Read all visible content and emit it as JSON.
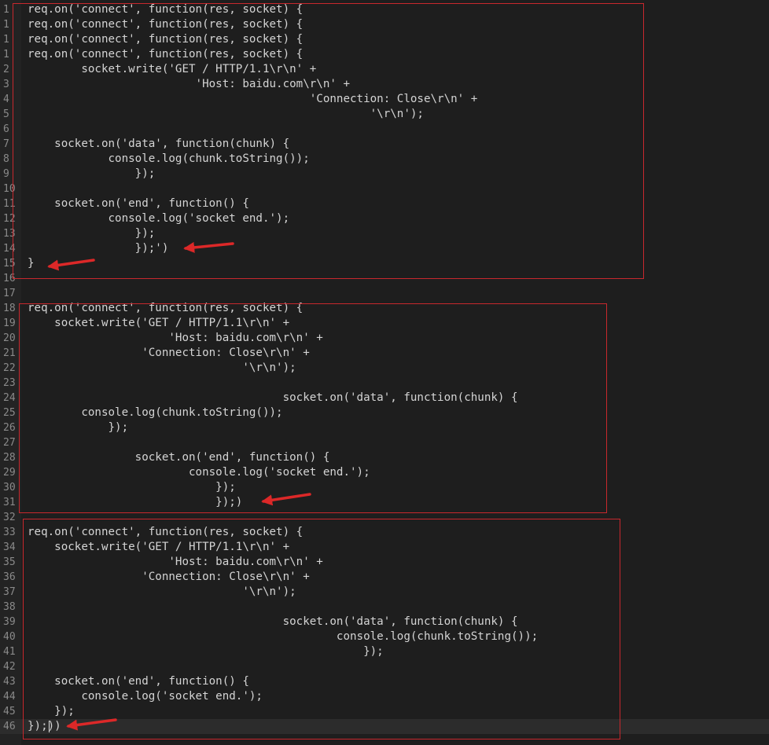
{
  "editor": {
    "current_line": 46,
    "lines": [
      {
        "n": "1",
        "text": "req.on('connect', function(res, socket) {"
      },
      {
        "n": "1",
        "text": "req.on('connect', function(res, socket) {"
      },
      {
        "n": "1",
        "text": "req.on('connect', function(res, socket) {"
      },
      {
        "n": "1",
        "text": "req.on('connect', function(res, socket) {"
      },
      {
        "n": "2",
        "text": "        socket.write('GET / HTTP/1.1\\r\\n' +"
      },
      {
        "n": "3",
        "text": "                         'Host: baidu.com\\r\\n' +"
      },
      {
        "n": "4",
        "text": "                                          'Connection: Close\\r\\n' +"
      },
      {
        "n": "5",
        "text": "                                                   '\\r\\n');"
      },
      {
        "n": "6",
        "text": ""
      },
      {
        "n": "7",
        "text": "    socket.on('data', function(chunk) {"
      },
      {
        "n": "8",
        "text": "            console.log(chunk.toString());"
      },
      {
        "n": "9",
        "text": "                });"
      },
      {
        "n": "10",
        "text": ""
      },
      {
        "n": "11",
        "text": "    socket.on('end', function() {"
      },
      {
        "n": "12",
        "text": "            console.log('socket end.');"
      },
      {
        "n": "13",
        "text": "                });"
      },
      {
        "n": "14",
        "text": "                });')"
      },
      {
        "n": "15",
        "text": "}"
      },
      {
        "n": "16",
        "text": ""
      },
      {
        "n": "17",
        "text": ""
      },
      {
        "n": "18",
        "text": "req.on('connect', function(res, socket) {"
      },
      {
        "n": "19",
        "text": "    socket.write('GET / HTTP/1.1\\r\\n' +"
      },
      {
        "n": "20",
        "text": "                     'Host: baidu.com\\r\\n' +"
      },
      {
        "n": "21",
        "text": "                 'Connection: Close\\r\\n' +"
      },
      {
        "n": "22",
        "text": "                                '\\r\\n');"
      },
      {
        "n": "23",
        "text": ""
      },
      {
        "n": "24",
        "text": "                                      socket.on('data', function(chunk) {"
      },
      {
        "n": "25",
        "text": "        console.log(chunk.toString());"
      },
      {
        "n": "26",
        "text": "            });"
      },
      {
        "n": "27",
        "text": ""
      },
      {
        "n": "28",
        "text": "                socket.on('end', function() {"
      },
      {
        "n": "29",
        "text": "                        console.log('socket end.');"
      },
      {
        "n": "30",
        "text": "                            });"
      },
      {
        "n": "31",
        "text": "                            });)"
      },
      {
        "n": "32",
        "text": ""
      },
      {
        "n": "33",
        "text": "req.on('connect', function(res, socket) {"
      },
      {
        "n": "34",
        "text": "    socket.write('GET / HTTP/1.1\\r\\n' +"
      },
      {
        "n": "35",
        "text": "                     'Host: baidu.com\\r\\n' +"
      },
      {
        "n": "36",
        "text": "                 'Connection: Close\\r\\n' +"
      },
      {
        "n": "37",
        "text": "                                '\\r\\n');"
      },
      {
        "n": "38",
        "text": ""
      },
      {
        "n": "39",
        "text": "                                      socket.on('data', function(chunk) {"
      },
      {
        "n": "40",
        "text": "                                              console.log(chunk.toString());"
      },
      {
        "n": "41",
        "text": "                                                  });"
      },
      {
        "n": "42",
        "text": ""
      },
      {
        "n": "43",
        "text": "    socket.on('end', function() {"
      },
      {
        "n": "44",
        "text": "        console.log('socket end.');"
      },
      {
        "n": "45",
        "text": "    });"
      },
      {
        "n": "46",
        "text": "});))"
      }
    ]
  },
  "annotations": {
    "color": "#c8282d",
    "boxes": [
      "box-1",
      "box-2",
      "box-3"
    ],
    "arrows": [
      "arrow-line-14",
      "arrow-line-15",
      "arrow-line-31",
      "arrow-line-46"
    ]
  }
}
